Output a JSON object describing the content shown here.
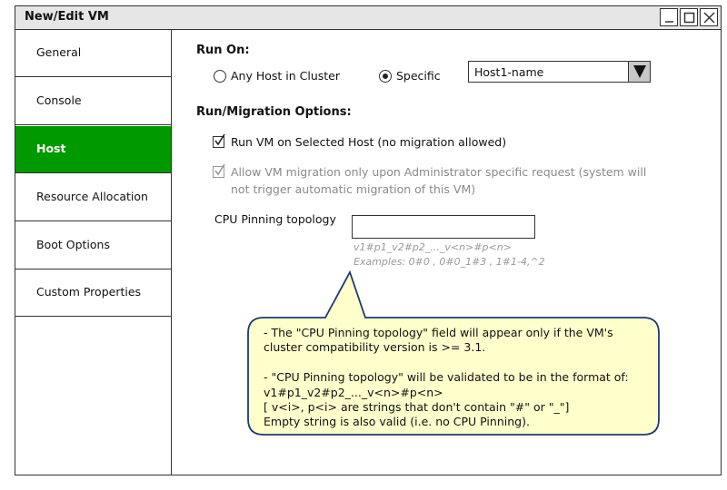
{
  "window": {
    "title": "New/Edit VM"
  },
  "sidebar": {
    "items": [
      {
        "label": "General",
        "active": false
      },
      {
        "label": "Console",
        "active": false
      },
      {
        "label": "Host",
        "active": true
      },
      {
        "label": "Resource Allocation",
        "active": false
      },
      {
        "label": "Boot Options",
        "active": false
      },
      {
        "label": "Custom Properties",
        "active": false
      }
    ]
  },
  "host": {
    "run_on_heading": "Run On:",
    "any_host_label": "Any Host in Cluster",
    "specific_label": "Specific",
    "selected_option": "specific",
    "host_select_value": "Host1-name",
    "migration_heading": "Run/Migration Options:",
    "run_selected_label": "Run VM on Selected Host (no migration allowed)",
    "run_selected_checked": true,
    "allow_migration_line1": "Allow VM migration only upon Administrator specific request (system will",
    "allow_migration_line2": "not trigger automatic migration of this VM)",
    "allow_migration_checked": true,
    "cpu_pinning_label": "CPU Pinning topology",
    "cpu_pinning_value": "",
    "cpu_hint_format": "v1#p1_v2#p2_..._v<n>#p<n>",
    "cpu_hint_examples": "Examples: 0#0 , 0#0_1#3 , 1#1-4,^2"
  },
  "callout": {
    "lines": [
      "- The \"CPU Pinning topology\" field will appear only if the VM's",
      "cluster compatibility version is >= 3.1.",
      "",
      "- \"CPU Pinning topology\" will be validated to be in the format of:",
      "v1#p1_v2#p2_..._v<n>#p<n>",
      "[ v<i>, p<i> are strings that don't contain \"#\" or \"_\"]",
      "Empty string is also valid (i.e. no CPU Pinning)."
    ]
  },
  "colors": {
    "active_nav": "#009900",
    "callout_fill": "#ffffcc",
    "callout_border": "#1f3a70"
  }
}
